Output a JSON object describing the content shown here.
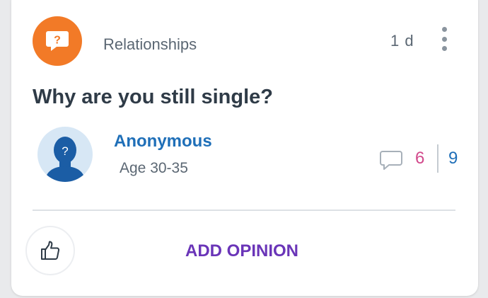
{
  "post": {
    "category": "Relationships",
    "category_icon": "question-mark-icon",
    "category_color": "#f27a27",
    "time_ago": "1 d",
    "question": "Why are you still single?"
  },
  "author": {
    "name": "Anonymous",
    "age": "Age 30-35",
    "avatar_icon": "anonymous-avatar-icon"
  },
  "stats": {
    "comment_icon": "comment-icon",
    "count_pink": "6",
    "count_blue": "9"
  },
  "actions": {
    "like_icon": "thumbs-up-icon",
    "add_opinion_label": "ADD OPINION"
  }
}
